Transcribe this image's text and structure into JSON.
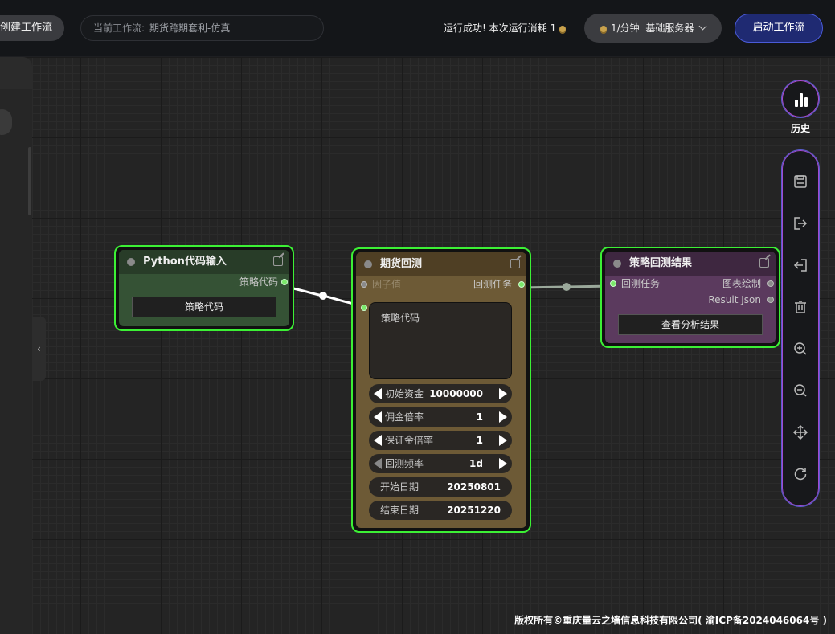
{
  "topbar": {
    "new_workflow": "创建工作流",
    "current_label": "当前工作流:",
    "current_name": "期货跨期套利-仿真",
    "run_status": "运行成功!  本次运行消耗 1",
    "server_rate": "1/分钟",
    "server_name": "基础服务器",
    "start_label": "启动工作流"
  },
  "nodes": {
    "python": {
      "title": "Python代码输入",
      "output_label": "策略代码",
      "button": "策略代码"
    },
    "backtest": {
      "title": "期货回测",
      "input_factor": "因子值",
      "output_task": "回测任务",
      "code_placeholder": "策略代码",
      "fields": [
        {
          "label": "初始资金",
          "value": "10000000"
        },
        {
          "label": "佣金倍率",
          "value": "1"
        },
        {
          "label": "保证金倍率",
          "value": "1"
        },
        {
          "label": "回测频率",
          "value": "1d"
        }
      ],
      "start_date_label": "开始日期",
      "start_date": "20250801",
      "end_date_label": "结束日期",
      "end_date": "20251220"
    },
    "result": {
      "title": "策略回测结果",
      "input_task": "回测任务",
      "output_chart": "图表绘制",
      "output_json": "Result Json",
      "button": "查看分析结果"
    }
  },
  "sidebar_right": {
    "history_label": "历史",
    "tools": [
      "save-icon",
      "export-icon",
      "import-icon",
      "trash-icon",
      "zoom-in-icon",
      "zoom-out-icon",
      "move-icon",
      "refresh-icon"
    ]
  },
  "footer": "版权所有©重庆量云之墙信息科技有限公司( 渝ICP备2024046064号 )",
  "colors": {
    "active_border": "#3cf035",
    "python_node": "#355235",
    "backtest_node": "#6d5a36",
    "result_node": "#5b3a5e",
    "accent": "#4a5bd8"
  }
}
